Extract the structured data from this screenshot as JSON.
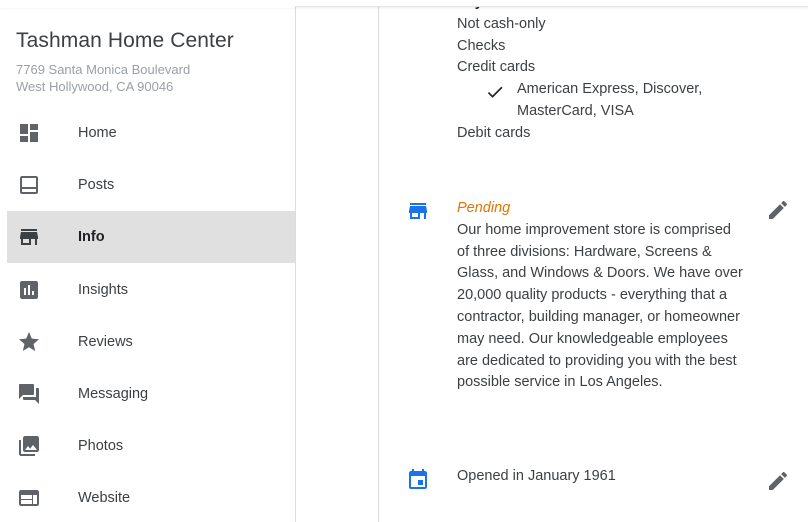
{
  "business": {
    "name": "Tashman Home Center",
    "address_line1": "7769 Santa Monica Boulevard",
    "address_line2": "West Hollywood, CA 90046"
  },
  "nav": [
    {
      "label": "Home",
      "icon": "dashboard-icon",
      "active": false
    },
    {
      "label": "Posts",
      "icon": "posts-icon",
      "active": false
    },
    {
      "label": "Info",
      "icon": "store-icon",
      "active": true
    },
    {
      "label": "Insights",
      "icon": "insights-icon",
      "active": false
    },
    {
      "label": "Reviews",
      "icon": "star-icon",
      "active": false
    },
    {
      "label": "Messaging",
      "icon": "messaging-icon",
      "active": false
    },
    {
      "label": "Photos",
      "icon": "photos-icon",
      "active": false
    },
    {
      "label": "Website",
      "icon": "website-icon",
      "active": false
    }
  ],
  "payments": {
    "heading": "Payments",
    "items": [
      "Not cash-only",
      "Checks",
      "Credit cards"
    ],
    "credit_cards_detail_1": "American Express, Discover,",
    "credit_cards_detail_2": "MasterCard, VISA",
    "last_item": "Debit cards"
  },
  "description": {
    "status": "Pending",
    "text": "Our home improvement store is comprised of three divisions: Hardware, Screens & Glass, and Windows & Doors. We have over 20,000 quality products - everything that a contractor, building manager, or homeowner may need. Our knowledgeable employees are dedicated to providing you with the best possible service in Los Angeles."
  },
  "opening": {
    "text": "Opened in January 1961"
  },
  "colors": {
    "accent": "#1a73e8",
    "pending": "#e37400",
    "active_nav_bg": "#e0e0e0"
  }
}
